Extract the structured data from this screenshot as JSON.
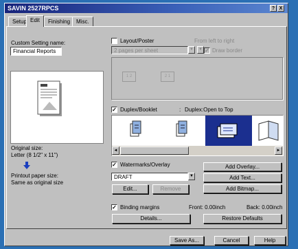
{
  "window": {
    "title": "SAVIN 2527RPCS",
    "help_label": "?",
    "close_label": "X"
  },
  "tabs": [
    {
      "label": "Setup"
    },
    {
      "label": "Edit"
    },
    {
      "label": "Finishing"
    },
    {
      "label": "Misc."
    }
  ],
  "custom_setting": {
    "label": "Custom Setting name:",
    "value": "Financial Reports"
  },
  "original_size": {
    "label": "Original size:",
    "value": "Letter (8 1/2\" x 11\")"
  },
  "printout_size": {
    "label": "Printout paper size:",
    "value": "Same as original size"
  },
  "layout": {
    "label": "Layout/Poster",
    "checked": false,
    "pages_value": "2 pages per sheet",
    "order_label": "From left to right",
    "draw_border_label": "Draw border",
    "page1": "1 2",
    "page2": "2 1"
  },
  "duplex": {
    "label": "Duplex/Booklet",
    "checked": true,
    "status_prefix": ":",
    "status": "Duplex:Open to Top"
  },
  "watermarks": {
    "label": "Watermarks/Overlay",
    "checked": true,
    "value": "DRAFT",
    "edit_label": "Edit...",
    "remove_label": "Remove",
    "add_overlay_label": "Add Overlay...",
    "add_text_label": "Add Text...",
    "add_bitmap_label": "Add Bitmap..."
  },
  "binding": {
    "label": "Binding margins",
    "checked": true,
    "front": "Front: 0.00inch",
    "back": "Back: 0.00inch",
    "details_label": "Details...",
    "restore_label": "Restore Defaults"
  },
  "footer": {
    "save_as_label": "Save As...",
    "cancel_label": "Cancel",
    "help_label": "Help"
  },
  "colors": {
    "accent": "#1b2f8f",
    "title_start": "#17237a",
    "title_end": "#5a86d0"
  },
  "icons": [
    "document-preview-icon",
    "down-arrow-icon",
    "booklet-icon"
  ]
}
